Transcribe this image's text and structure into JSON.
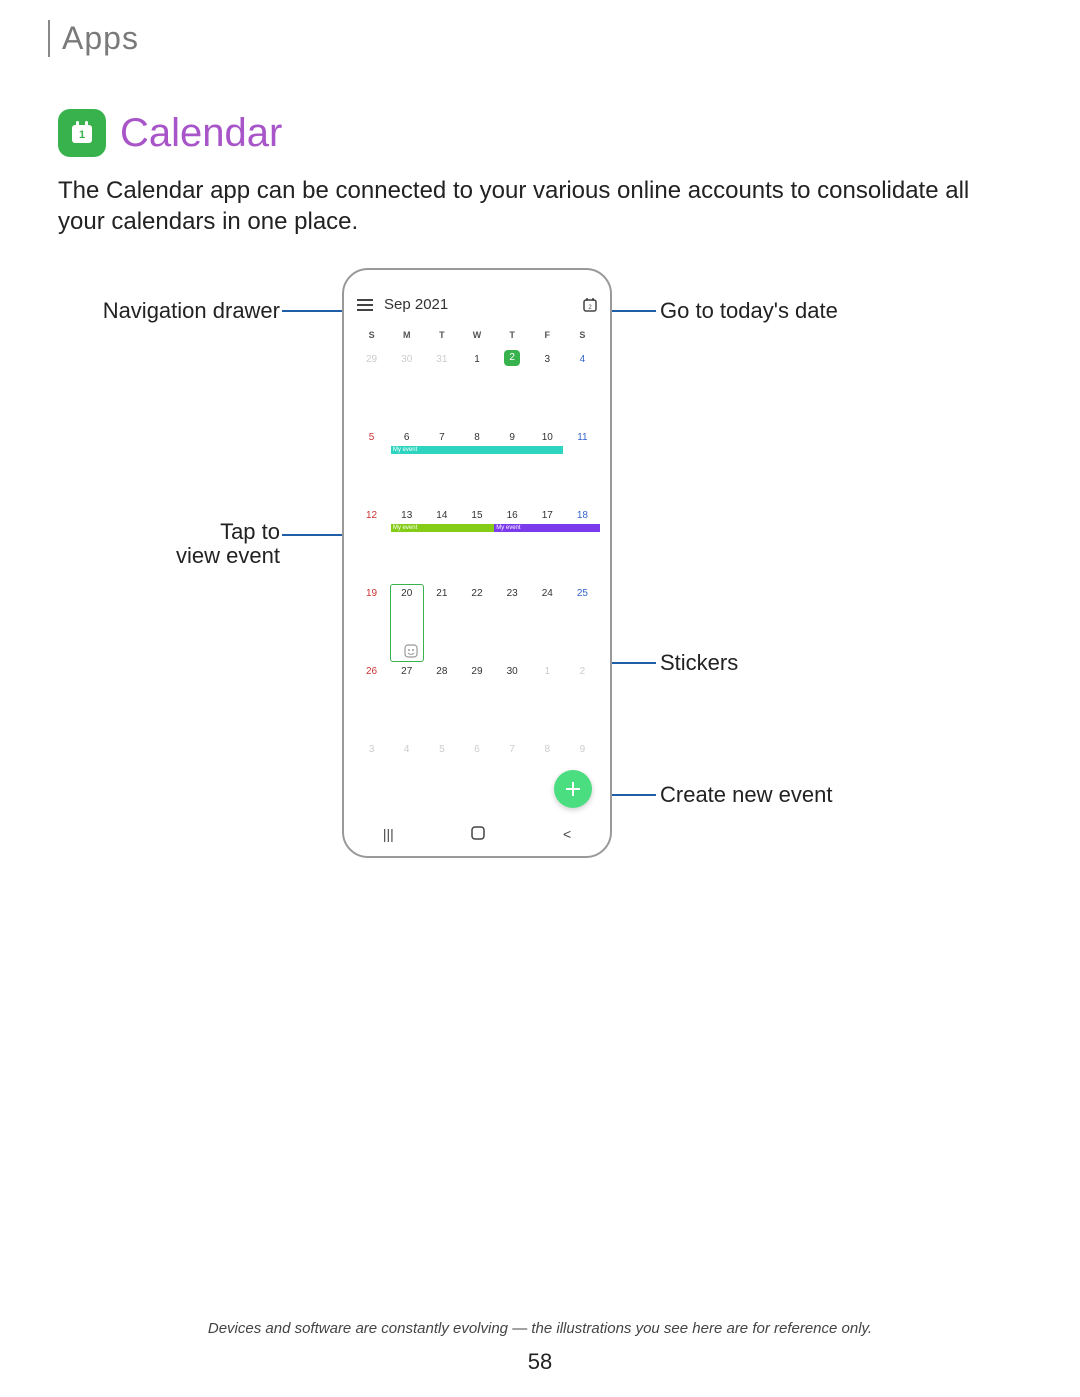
{
  "header": {
    "section": "Apps"
  },
  "app": {
    "name": "Calendar",
    "description": "The Calendar app can be connected to your various online accounts to consolidate all your calendars in one place."
  },
  "phone": {
    "month_label": "Sep 2021",
    "dow": [
      "S",
      "M",
      "T",
      "W",
      "T",
      "F",
      "S"
    ],
    "weeks": [
      [
        {
          "n": "29",
          "dim": true
        },
        {
          "n": "30",
          "dim": true
        },
        {
          "n": "31",
          "dim": true
        },
        {
          "n": "1"
        },
        {
          "n": "2",
          "today": true
        },
        {
          "n": "3"
        },
        {
          "n": "4"
        }
      ],
      [
        {
          "n": "5"
        },
        {
          "n": "6"
        },
        {
          "n": "7"
        },
        {
          "n": "8"
        },
        {
          "n": "9"
        },
        {
          "n": "10"
        },
        {
          "n": "11"
        }
      ],
      [
        {
          "n": "12"
        },
        {
          "n": "13"
        },
        {
          "n": "14"
        },
        {
          "n": "15"
        },
        {
          "n": "16"
        },
        {
          "n": "17"
        },
        {
          "n": "18"
        }
      ],
      [
        {
          "n": "19"
        },
        {
          "n": "20"
        },
        {
          "n": "21"
        },
        {
          "n": "22"
        },
        {
          "n": "23"
        },
        {
          "n": "24"
        },
        {
          "n": "25"
        }
      ],
      [
        {
          "n": "26"
        },
        {
          "n": "27"
        },
        {
          "n": "28"
        },
        {
          "n": "29"
        },
        {
          "n": "30"
        },
        {
          "n": "1",
          "dim": true
        },
        {
          "n": "2",
          "dim": true
        }
      ],
      [
        {
          "n": "3",
          "dim": true
        },
        {
          "n": "4",
          "dim": true
        },
        {
          "n": "5",
          "dim": true
        },
        {
          "n": "6",
          "dim": true
        },
        {
          "n": "7",
          "dim": true
        },
        {
          "n": "8",
          "dim": true
        },
        {
          "n": "9",
          "dim": true
        }
      ]
    ],
    "events": {
      "week1_label": "My event",
      "week2_a_label": "My event",
      "week2_b_label": "My event"
    }
  },
  "callouts": {
    "nav_drawer": "Navigation drawer",
    "go_today": "Go to today's date",
    "tap_view": "Tap to\nview event",
    "stickers": "Stickers",
    "create": "Create new event"
  },
  "footer": {
    "note": "Devices and software are constantly evolving — the illustrations you see here are for reference only.",
    "page": "58"
  }
}
